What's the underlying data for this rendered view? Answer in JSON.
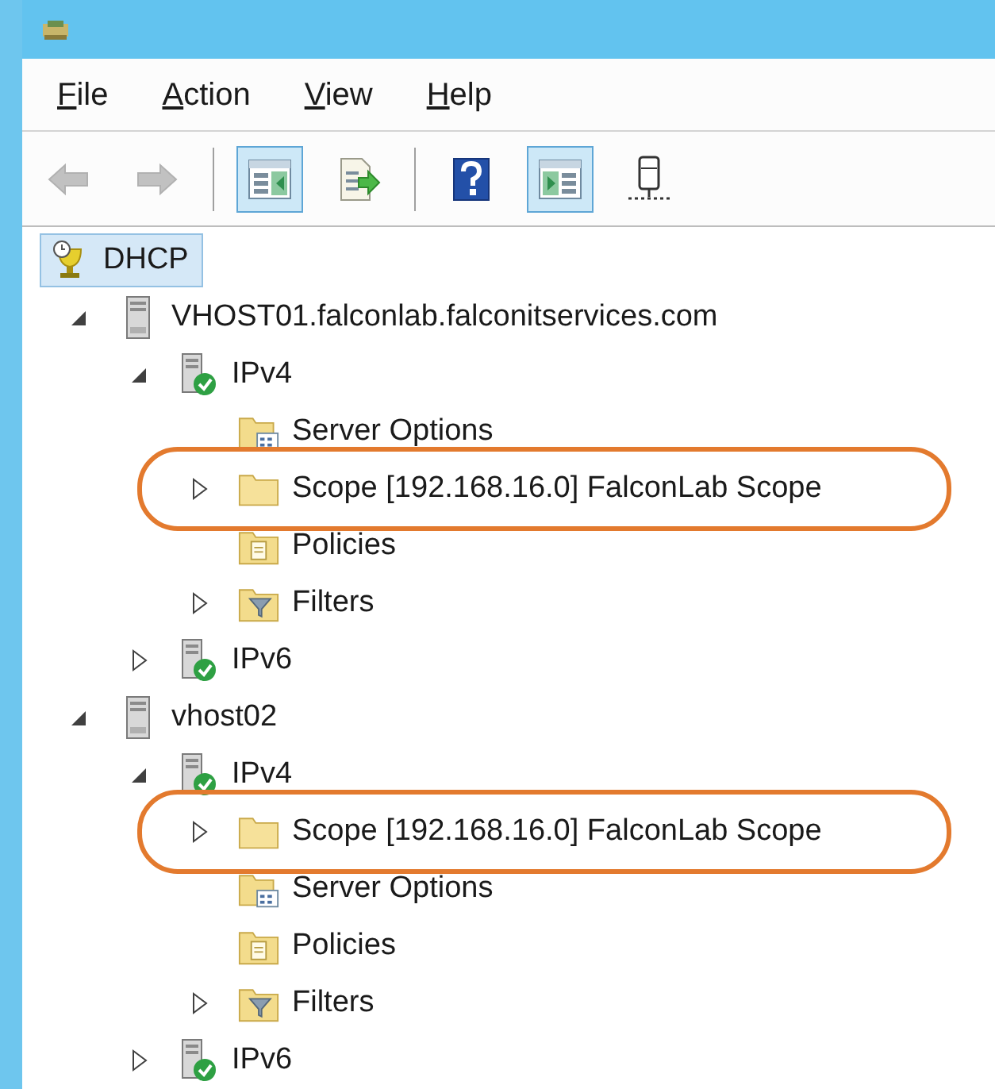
{
  "menu": [
    {
      "label": "File"
    },
    {
      "label": "Action"
    },
    {
      "label": "View"
    },
    {
      "label": "Help"
    }
  ],
  "toolbar": [
    {
      "kind": "back",
      "disabled": true,
      "pressed": false
    },
    {
      "kind": "forward",
      "disabled": true,
      "pressed": false
    },
    {
      "kind": "separator"
    },
    {
      "kind": "tree_pane",
      "disabled": false,
      "pressed": true
    },
    {
      "kind": "export",
      "disabled": false,
      "pressed": false
    },
    {
      "kind": "separator"
    },
    {
      "kind": "help",
      "disabled": false,
      "pressed": false
    },
    {
      "kind": "action_pane",
      "disabled": false,
      "pressed": true
    },
    {
      "kind": "server",
      "disabled": false,
      "pressed": false
    }
  ],
  "tree": [
    {
      "label": "DHCP",
      "kind": "root",
      "selected": true,
      "circled": false,
      "children": [
        {
          "label": "VHOST01.falconlab.falconitservices.com",
          "kind": "server",
          "expanded": true,
          "selected": false,
          "circled": false,
          "children": [
            {
              "label": "IPv4",
              "kind": "protocol",
              "expanded": true,
              "selected": false,
              "circled": false,
              "children": [
                {
                  "label": "Server Options",
                  "kind": "options",
                  "selected": false,
                  "circled": false
                },
                {
                  "label": "Scope [192.168.16.0] FalconLab Scope",
                  "kind": "scope",
                  "expanded": false,
                  "selected": false,
                  "circled": true
                },
                {
                  "label": "Policies",
                  "kind": "policies",
                  "selected": false,
                  "circled": false
                },
                {
                  "label": "Filters",
                  "kind": "filters",
                  "expanded": false,
                  "selected": false,
                  "circled": false
                }
              ]
            },
            {
              "label": "IPv6",
              "kind": "protocol",
              "expanded": false,
              "selected": false,
              "circled": false
            }
          ]
        },
        {
          "label": "vhost02",
          "kind": "server",
          "expanded": true,
          "selected": false,
          "circled": false,
          "children": [
            {
              "label": "IPv4",
              "kind": "protocol",
              "expanded": true,
              "selected": false,
              "circled": false,
              "children": [
                {
                  "label": "Scope [192.168.16.0] FalconLab Scope",
                  "kind": "scope",
                  "expanded": false,
                  "selected": false,
                  "circled": true
                },
                {
                  "label": "Server Options",
                  "kind": "options",
                  "selected": false,
                  "circled": false
                },
                {
                  "label": "Policies",
                  "kind": "policies",
                  "selected": false,
                  "circled": false
                },
                {
                  "label": "Filters",
                  "kind": "filters",
                  "expanded": false,
                  "selected": false,
                  "circled": false
                }
              ]
            },
            {
              "label": "IPv6",
              "kind": "protocol",
              "expanded": false,
              "selected": false,
              "circled": false
            }
          ]
        }
      ]
    }
  ]
}
